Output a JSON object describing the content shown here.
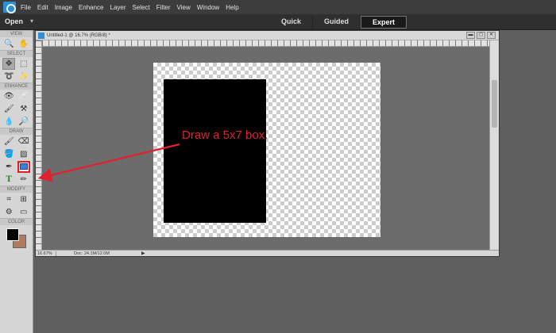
{
  "menubar": {
    "items": [
      "File",
      "Edit",
      "Image",
      "Enhance",
      "Layer",
      "Select",
      "Filter",
      "View",
      "Window",
      "Help"
    ]
  },
  "modebar": {
    "open_label": "Open",
    "open_caret": "▾",
    "tabs": [
      "Quick",
      "Guided",
      "Expert"
    ],
    "active_tab": "Expert"
  },
  "toolbox": {
    "sections": {
      "view": "VIEW",
      "select": "SELECT",
      "enhance": "ENHANCE",
      "draw": "DRAW",
      "modify": "MODIFY",
      "color": "COLOR"
    },
    "foreground_color": "#000000",
    "background_color": "#b07a60"
  },
  "document": {
    "title": "Untitled-1 @ 16.7% (RGB/8) *",
    "zoom": "16.67%",
    "doc_size": "Doc: 24.1M/12.0M",
    "status_arrow": "▶",
    "controls": {
      "minimize": "▬",
      "maximize": "◻",
      "close": "✕"
    }
  },
  "annotation": {
    "text": "Draw a 5x7 box.",
    "color": "#e22030"
  }
}
